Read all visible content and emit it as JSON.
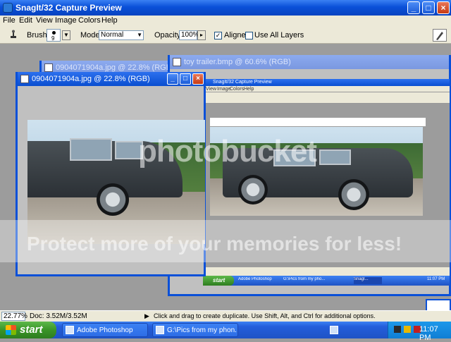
{
  "app": {
    "title": "SnagIt/32 Capture Preview",
    "controls": {
      "minimize": "_",
      "maximize": "□",
      "close": "×"
    }
  },
  "menu": [
    "File",
    "Edit",
    "View",
    "Image",
    "Colors",
    "Help"
  ],
  "options": {
    "brush_label": "Brush:",
    "brush_size": "9",
    "mode_label": "Mode:",
    "mode_value": "Normal",
    "opacity_label": "Opacity:",
    "opacity_value": "100%",
    "aligned_label": "Aligned",
    "aligned_checked": true,
    "use_all_layers_label": "Use All Layers",
    "use_all_layers_checked": false
  },
  "windows": [
    {
      "title": "0904071904a.jpg @ 22.8% (RGB)"
    },
    {
      "title": "toy trailer.bmp @ 60.6% (RGB)"
    },
    {
      "title": "0904071904a.jpg @ 22.8% (RGB)"
    }
  ],
  "capture_window": {
    "title": "SnagIt/32 Capture Preview",
    "menu": [
      "View",
      "Image",
      "Colors",
      "Help"
    ],
    "start": "start",
    "tasks": [
      "Adobe Photoshop",
      "G:\\Pics from my pho...",
      "SnagI..."
    ],
    "clock": "11:07 PM"
  },
  "status": {
    "zoom": "22.77%",
    "doc": "Doc: 3.52M/3.52M",
    "hint": "Click and drag to create duplicate. Use Shift, Alt, and Ctrl for additional options."
  },
  "taskbar": {
    "start": "start",
    "items": [
      {
        "label": "Adobe Photoshop",
        "active": false
      },
      {
        "label": "G:\\Pics from my phon...",
        "active": false
      }
    ],
    "clock": "11:07 PM"
  },
  "watermark": {
    "brand": "photobucket",
    "slogan": "Protect more of your memories for less!"
  },
  "icons": [
    "snagit-icon",
    "clone-stamp-icon",
    "brush-picker-icon",
    "tool-preset-icon",
    "document-icon",
    "windows-flag-icon"
  ],
  "colors": {
    "xp_blue": "#0a50d8",
    "start_green": "#3a9427",
    "chrome": "#ece9d8"
  }
}
